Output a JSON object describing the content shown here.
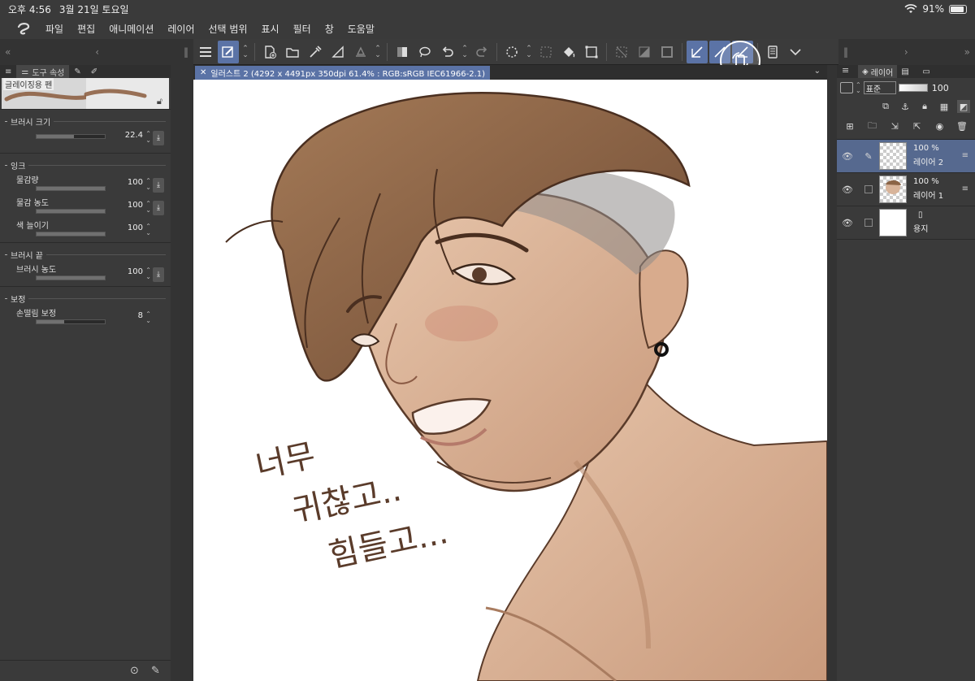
{
  "status_bar": {
    "time": "오후 4:56",
    "date": "3월 21일 토요일",
    "battery": "91%",
    "battery_level": 0.91
  },
  "menu": [
    "파일",
    "편집",
    "애니메이션",
    "레이어",
    "선택 범위",
    "표시",
    "필터",
    "창",
    "도움말"
  ],
  "tool_property": {
    "tab_label": "도구 속성",
    "brush_name": "글레이징용 펜",
    "sections": [
      {
        "title": "브러시 크기",
        "rows": [
          {
            "label": "",
            "value": "22.4",
            "level": 0.55,
            "has_download": true
          }
        ]
      },
      {
        "title": "잉크",
        "rows": [
          {
            "label": "물감량",
            "value": "100",
            "level": 1.0,
            "has_download": true
          },
          {
            "label": "물감 농도",
            "value": "100",
            "level": 1.0,
            "has_download": true
          },
          {
            "label": "색 늘이기",
            "value": "100",
            "level": 1.0,
            "has_download": false
          }
        ]
      },
      {
        "title": "브러시 끝",
        "rows": [
          {
            "label": "브러시 농도",
            "value": "100",
            "level": 1.0,
            "has_download": true
          }
        ]
      },
      {
        "title": "보정",
        "rows": [
          {
            "label": "손떨림 보정",
            "value": "8",
            "level": 0.4,
            "has_download": false
          }
        ]
      }
    ]
  },
  "document": {
    "tab_title": "일러스트 2 (4292 x 4491px 350dpi 61.4% : RGB:sRGB IEC61966-2.1)"
  },
  "canvas_text": [
    "너무",
    "귀찮고..",
    "힘들고..."
  ],
  "layer_panel": {
    "tab_label": "레이어",
    "blend_mode": "표준",
    "opacity": "100",
    "layers": [
      {
        "name": "레이어 2",
        "opacity": "100 %",
        "selected": true,
        "thumb": "checker"
      },
      {
        "name": "레이어 1",
        "opacity": "100 %",
        "selected": false,
        "thumb": "portrait"
      },
      {
        "name": "용지",
        "opacity": "",
        "selected": false,
        "thumb": "white"
      }
    ]
  },
  "colors": {
    "accent": "#5b73a6",
    "panel": "#3a3a3a",
    "skin": "#d8b49a",
    "hair": "#8b6446",
    "line": "#5a3b2a"
  }
}
